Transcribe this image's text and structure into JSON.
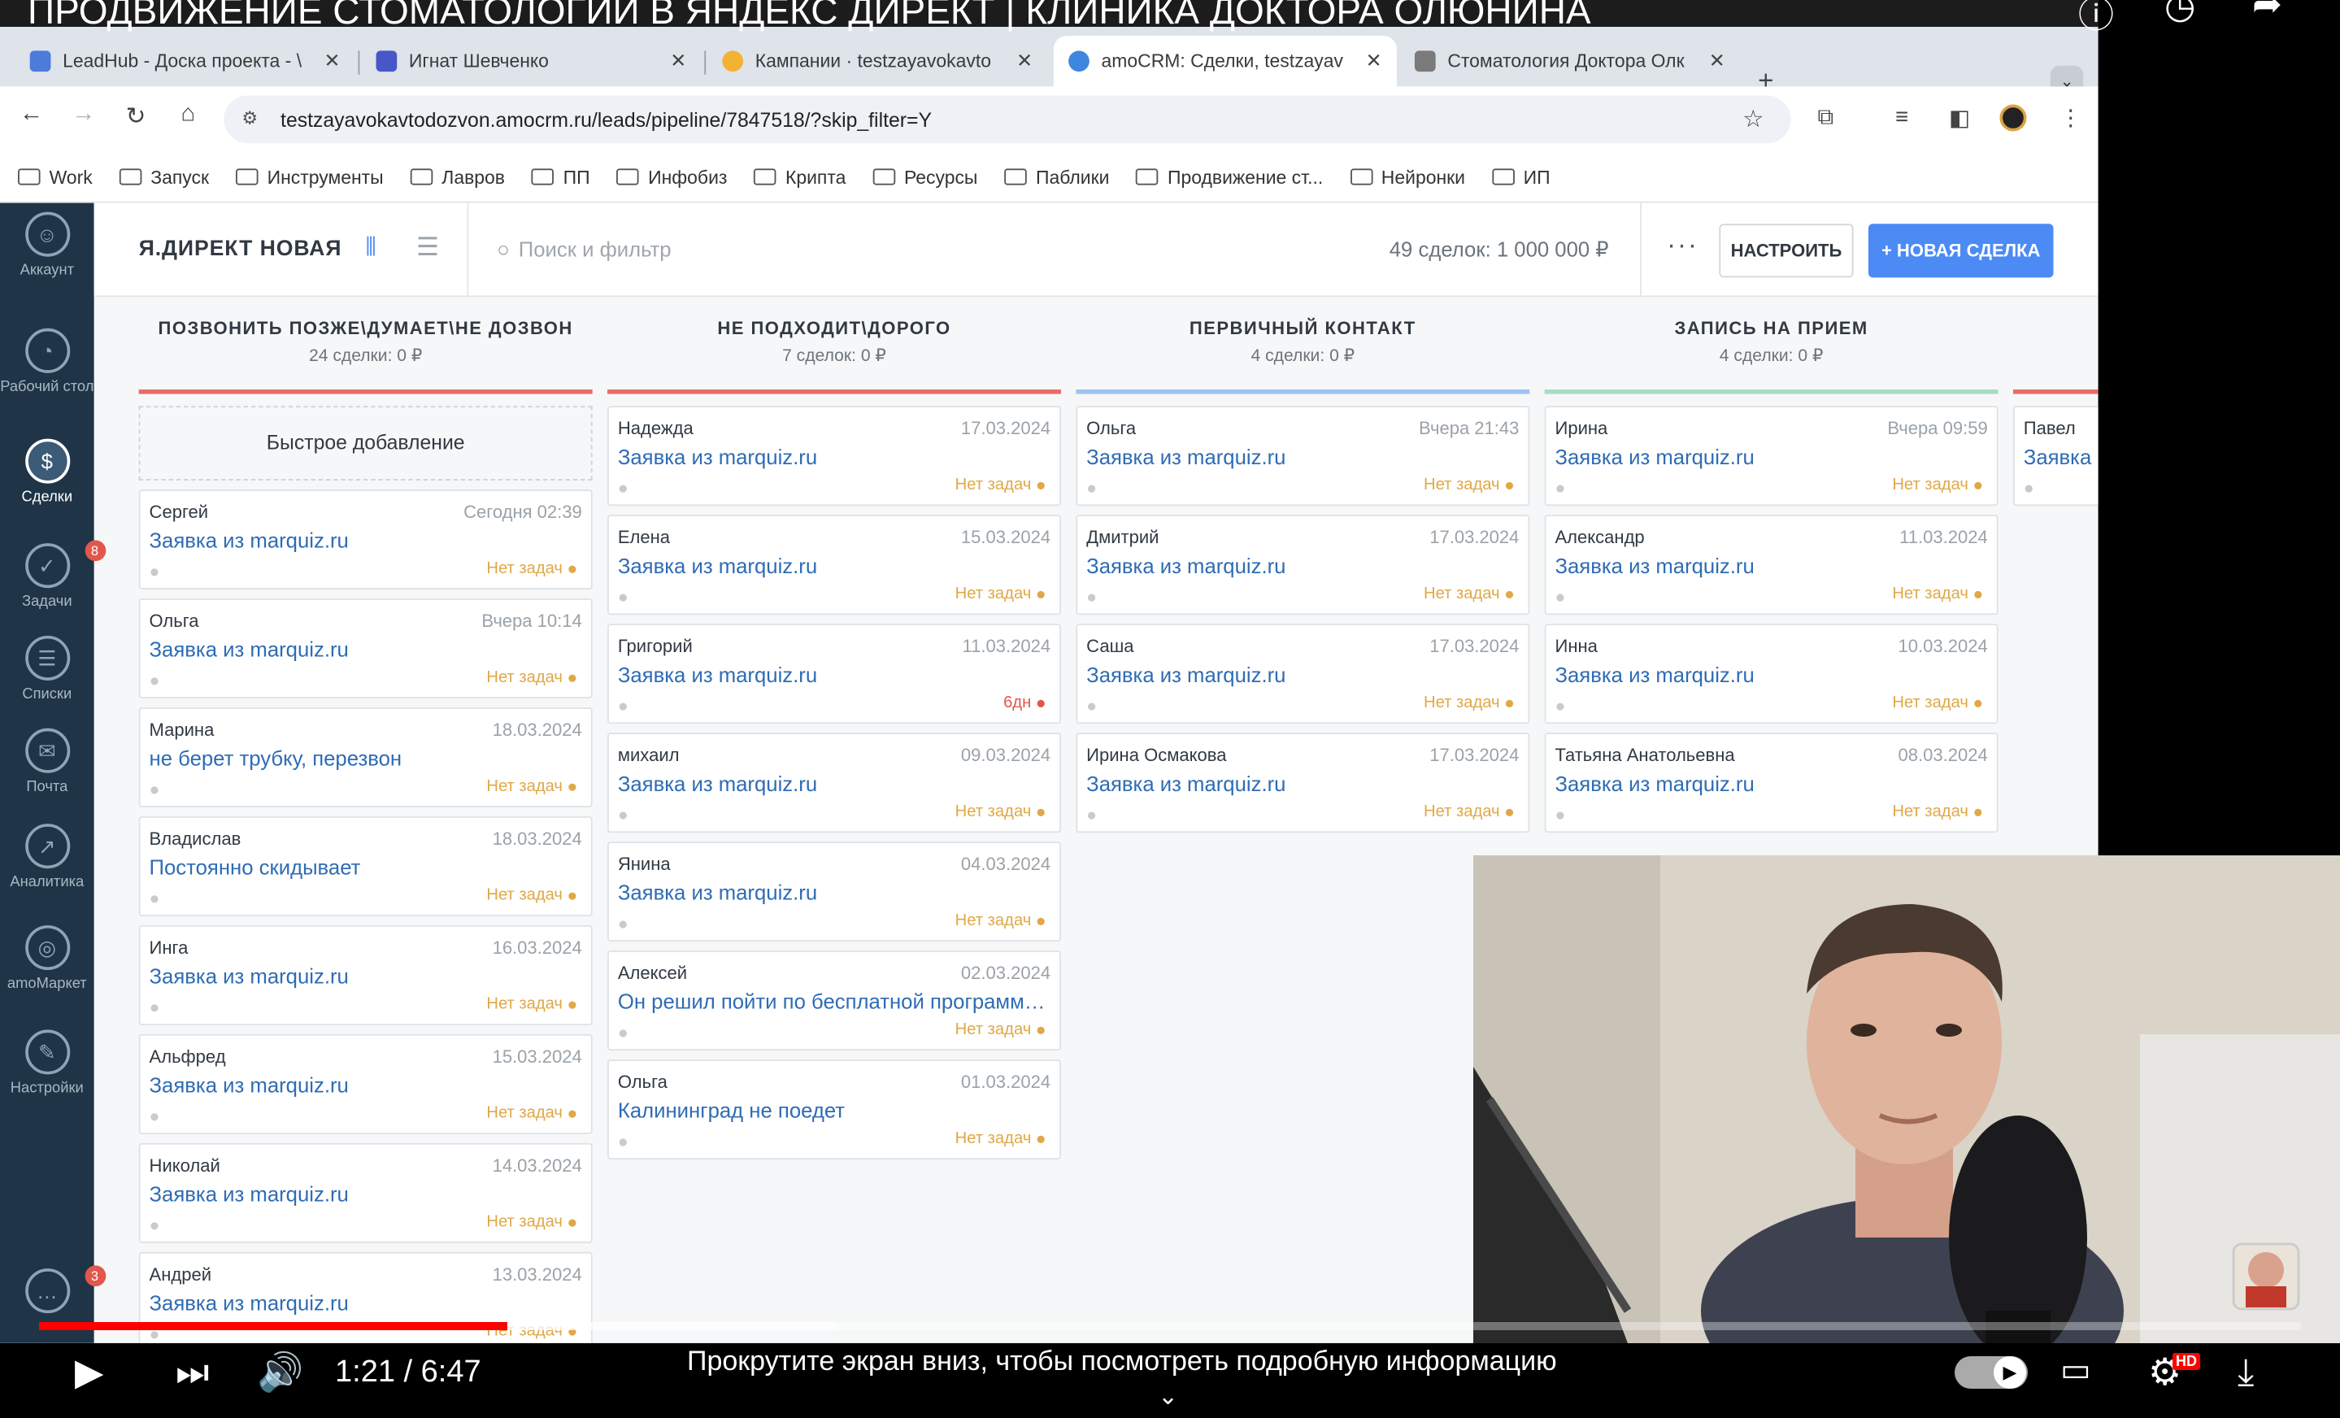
{
  "video": {
    "title": "ПРОДВИЖЕНИЕ СТОМАТОЛОГИИ В ЯНДЕКС ДИРЕКТ | КЛИНИКА ДОКТОРА ОЛЮНИНА",
    "time": "1:21 / 6:47",
    "progress_fraction": 0.207,
    "buffered_fraction": 0.146,
    "scroll_hint": "Прокрутите экран вниз, чтобы посмотреть подробную информацию",
    "icons": [
      "info-icon",
      "clock-icon",
      "share-icon",
      "play-icon",
      "next-icon",
      "volume-icon",
      "autoplay-toggle-icon",
      "subtitles-icon",
      "settings-icon",
      "fullscreen-exit-icon"
    ],
    "hd_badge": "HD"
  },
  "browser": {
    "tabs": [
      {
        "title": "LeadHub - Доска проекта - \\",
        "favcolor": "#4c7bd9"
      },
      {
        "title": "Игнат Шевченко",
        "favcolor": "#4756c9"
      },
      {
        "title": "Кампании · testzayavokavto",
        "favcolor": "#f2b233"
      },
      {
        "title": "amoCRM: Сделки, testzayav",
        "favcolor": "#3f86e0"
      },
      {
        "title": "Стоматология Доктора Олк",
        "favcolor": "#7a7a7a"
      }
    ],
    "url": "testzayavokavtodozvon.amocrm.ru/leads/pipeline/7847518/?skip_filter=Y",
    "bookmarks": [
      "Work",
      "Запуск",
      "Инструменты",
      "Лавров",
      "ПП",
      "Инфобиз",
      "Крипта",
      "Ресурсы",
      "Паблики",
      "Продвижение ст...",
      "Нейронки",
      "ИП"
    ]
  },
  "crm": {
    "sidebar": [
      {
        "label": "Аккаунт",
        "icon": "account-icon"
      },
      {
        "label": "Рабочий стол",
        "icon": "dashboard-icon"
      },
      {
        "label": "Сделки",
        "icon": "deals-icon"
      },
      {
        "label": "Задачи",
        "icon": "tasks-icon",
        "badge": "8"
      },
      {
        "label": "Списки",
        "icon": "lists-icon"
      },
      {
        "label": "Почта",
        "icon": "mail-icon"
      },
      {
        "label": "Аналитика",
        "icon": "analytics-icon"
      },
      {
        "label": "amoМаркет",
        "icon": "market-icon"
      },
      {
        "label": "Настройки",
        "icon": "settings-icon"
      }
    ],
    "chat_badge": "3",
    "pipeline_title": "Я.ДИРЕКТ НОВАЯ",
    "search_placeholder": "Поиск и фильтр",
    "summary": "49 сделок: 1 000 000 ₽",
    "setup_label": "НАСТРОИТЬ",
    "new_deal_label": "+ НОВАЯ СДЕЛКА",
    "quick_add": "Быстрое добавление",
    "columns": [
      {
        "name": "ПОЗВОНИТЬ ПОЗЖЕ\\ДУМАЕТ\\НЕ ДОЗВОН",
        "count": "24 сделки: 0 ₽",
        "color": "#e86b6b",
        "cards": [
          {
            "name": "Сергей",
            "date": "Сегодня 02:39",
            "title": "Заявка из marquiz.ru",
            "status": "Нет задач"
          },
          {
            "name": "Ольга",
            "date": "Вчера 10:14",
            "title": "Заявка из marquiz.ru",
            "status": "Нет задач"
          },
          {
            "name": "Марина",
            "date": "18.03.2024",
            "title": "не берет трубку, перезвон",
            "status": "Нет задач"
          },
          {
            "name": "Владислав",
            "date": "18.03.2024",
            "title": "Постоянно скидывает",
            "status": "Нет задач"
          },
          {
            "name": "Инга",
            "date": "16.03.2024",
            "title": "Заявка из marquiz.ru",
            "status": "Нет задач"
          },
          {
            "name": "Альфред",
            "date": "15.03.2024",
            "title": "Заявка из marquiz.ru",
            "status": "Нет задач"
          },
          {
            "name": "Николай",
            "date": "14.03.2024",
            "title": "Заявка из marquiz.ru",
            "status": "Нет задач"
          },
          {
            "name": "Андрей",
            "date": "13.03.2024",
            "title": "Заявка из marquiz.ru",
            "status": "Нет задач"
          }
        ]
      },
      {
        "name": "НЕ ПОДХОДИТ\\ДОРОГО",
        "count": "7 сделок: 0 ₽",
        "color": "#e86b6b",
        "cards": [
          {
            "name": "Надежда",
            "date": "17.03.2024",
            "title": "Заявка из marquiz.ru",
            "status": "Нет задач"
          },
          {
            "name": "Елена",
            "date": "15.03.2024",
            "title": "Заявка из marquiz.ru",
            "status": "Нет задач"
          },
          {
            "name": "Григорий",
            "date": "11.03.2024",
            "title": "Заявка из marquiz.ru",
            "status": "6дн"
          },
          {
            "name": "михаил",
            "date": "09.03.2024",
            "title": "Заявка из marquiz.ru",
            "status": "Нет задач"
          },
          {
            "name": "Янина",
            "date": "04.03.2024",
            "title": "Заявка из marquiz.ru",
            "status": "Нет задач"
          },
          {
            "name": "Алексей",
            "date": "02.03.2024",
            "title": "Он решил пойти по бесплатной программе ...",
            "status": "Нет задач"
          },
          {
            "name": "Ольга",
            "date": "01.03.2024",
            "title": "Калининград не поедет",
            "status": "Нет задач"
          }
        ]
      },
      {
        "name": "ПЕРВИЧНЫЙ КОНТАКТ",
        "count": "4 сделки: 0 ₽",
        "color": "#9fc3ef",
        "cards": [
          {
            "name": "Ольга",
            "date": "Вчера 21:43",
            "title": "Заявка из marquiz.ru",
            "status": "Нет задач"
          },
          {
            "name": "Дмитрий",
            "date": "17.03.2024",
            "title": "Заявка из marquiz.ru",
            "status": "Нет задач"
          },
          {
            "name": "Саша",
            "date": "17.03.2024",
            "title": "Заявка из marquiz.ru",
            "status": "Нет задач"
          },
          {
            "name": "Ирина Осмакова",
            "date": "17.03.2024",
            "title": "Заявка из marquiz.ru",
            "status": "Нет задач"
          }
        ]
      },
      {
        "name": "ЗАПИСЬ НА ПРИЕМ",
        "count": "4 сделки: 0 ₽",
        "color": "#a8dcc2",
        "cards": [
          {
            "name": "Ирина",
            "date": "Вчера 09:59",
            "title": "Заявка из marquiz.ru",
            "status": "Нет задач"
          },
          {
            "name": "Александр",
            "date": "11.03.2024",
            "title": "Заявка из marquiz.ru",
            "status": "Нет задач"
          },
          {
            "name": "Инна",
            "date": "10.03.2024",
            "title": "Заявка из marquiz.ru",
            "status": "Нет задач"
          },
          {
            "name": "Татьяна Анатольевна",
            "date": "08.03.2024",
            "title": "Заявка из marquiz.ru",
            "status": "Нет задач"
          }
        ]
      },
      {
        "name": "",
        "count": "",
        "color": "#e86b6b",
        "cards": [
          {
            "name": "Павел",
            "date": "",
            "title": "Заявка",
            "status": ""
          }
        ]
      }
    ]
  }
}
